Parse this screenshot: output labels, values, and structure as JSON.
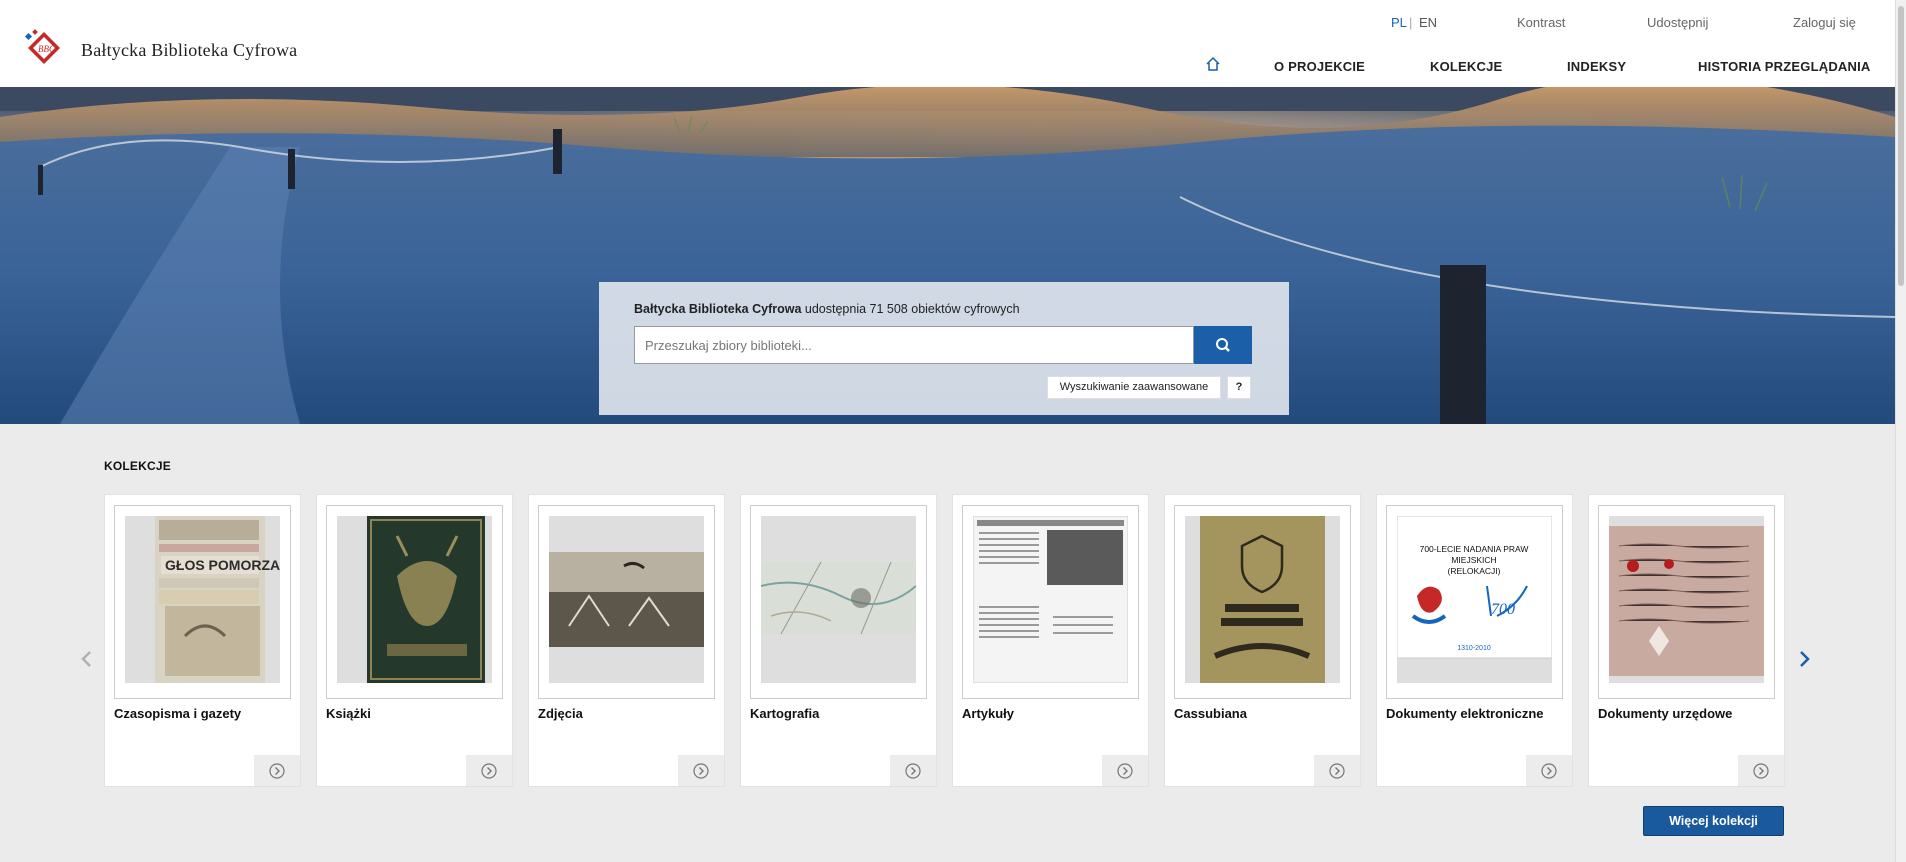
{
  "site": {
    "name": "Bałtycka Biblioteka Cyfrowa"
  },
  "top_bar": {
    "lang_pl": "PL",
    "lang_separator": "|",
    "lang_en": "EN",
    "contrast": "Kontrast",
    "share": "Udostępnij",
    "login": "Zaloguj się"
  },
  "nav": {
    "home_icon": "home-icon",
    "items": [
      "O PROJEKCIE",
      "KOLEKCJE",
      "INDEKSY",
      "HISTORIA PRZEGLĄDANIA"
    ]
  },
  "search": {
    "caption_bold": "Bałtycka Biblioteka Cyfrowa",
    "caption_rest": " udostępnia 71 508 obiektów cyfrowych",
    "placeholder": "Przeszukaj zbiory biblioteki...",
    "button_icon": "search-icon",
    "advanced": "Wyszukiwanie zaawansowane",
    "help": "?"
  },
  "collections": {
    "title": "KOLEKCJE",
    "items": [
      {
        "title": "Czasopisma i gazety",
        "thumb": "newspapers"
      },
      {
        "title": "Książki",
        "thumb": "book"
      },
      {
        "title": "Zdjęcia",
        "thumb": "photo"
      },
      {
        "title": "Kartografia",
        "thumb": "map"
      },
      {
        "title": "Artykuły",
        "thumb": "article"
      },
      {
        "title": "Cassubiana",
        "thumb": "cassubiana"
      },
      {
        "title": "Dokumenty elektroniczne",
        "thumb": "poster"
      },
      {
        "title": "Dokumenty urzędowe",
        "thumb": "manuscript"
      }
    ],
    "poster_text": {
      "line1": "700-LECIE NADANIA PRAW",
      "line2": "MIEJSKICH",
      "line3": "(RELOKACJI)",
      "year": "1310-2010"
    },
    "more_button": "Więcej kolekcji"
  },
  "colors": {
    "accent": "#1a5fa8",
    "lang_active": "#1565c0"
  }
}
